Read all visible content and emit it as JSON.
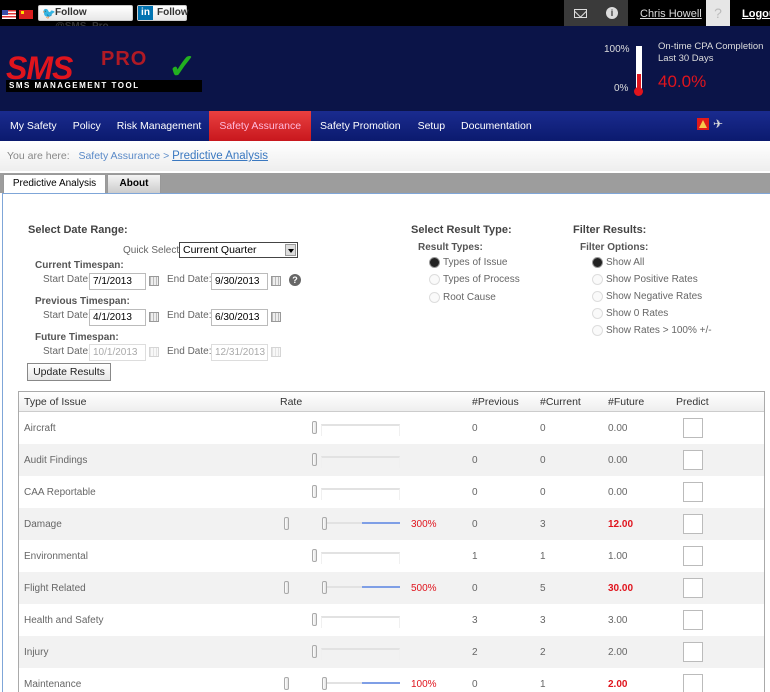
{
  "topbar": {
    "flags": [
      "us-flag-icon",
      "china-flag-icon"
    ],
    "twitter_label": "Follow @SMS_Pro",
    "linkedin_label": "Follow",
    "linkedin_icon_text": "in",
    "user_name": "Chris Howell",
    "logout_label": "Logout"
  },
  "header": {
    "logo": {
      "sms": "SMS",
      "pro": "PRO",
      "subtitle": "SMS MANAGEMENT TOOL",
      "check": "✓"
    },
    "kpi": {
      "scale_max": "100%",
      "scale_min": "0%",
      "title_line1": "On-time CPA Completion",
      "title_line2": "Last 30 Days",
      "value": "40.0%",
      "fill_fraction": 0.4,
      "color": "#e0141d"
    }
  },
  "nav": {
    "items": [
      {
        "label": "My Safety",
        "active": false
      },
      {
        "label": "Policy",
        "active": false
      },
      {
        "label": "Risk Management",
        "active": false
      },
      {
        "label": "Safety Assurance",
        "active": true
      },
      {
        "label": "Safety Promotion",
        "active": false
      },
      {
        "label": "Setup",
        "active": false
      },
      {
        "label": "Documentation",
        "active": false
      }
    ]
  },
  "breadcrumb": {
    "prefix": "You are here:",
    "parent": "Safety Assurance",
    "separator": ">",
    "current": "Predictive Analysis"
  },
  "tabs": [
    {
      "label": "Predictive Analysis",
      "active": true
    },
    {
      "label": "About",
      "active": false
    }
  ],
  "date_range": {
    "title": "Select Date Range:",
    "quick_select_label": "Quick Select:",
    "quick_select_value": "Current Quarter",
    "start_label": "Start Date:",
    "end_label": "End Date:",
    "current": {
      "title": "Current Timespan:",
      "start": "7/1/2013",
      "end": "9/30/2013"
    },
    "previous": {
      "title": "Previous Timespan:",
      "start": "4/1/2013",
      "end": "6/30/2013"
    },
    "future": {
      "title": "Future Timespan:",
      "start": "10/1/2013",
      "end": "12/31/2013"
    },
    "help_icon": "?",
    "update_button": "Update Results"
  },
  "result_type": {
    "title": "Select Result Type:",
    "subtitle": "Result Types:",
    "options": [
      {
        "label": "Types of Issue",
        "selected": true
      },
      {
        "label": "Types of Process",
        "selected": false
      },
      {
        "label": "Root Cause",
        "selected": false
      }
    ]
  },
  "filter": {
    "title": "Filter Results:",
    "subtitle": "Filter Options:",
    "options": [
      {
        "label": "Show All",
        "selected": true
      },
      {
        "label": "Show Positive Rates",
        "selected": false
      },
      {
        "label": "Show Negative Rates",
        "selected": false
      },
      {
        "label": "Show 0 Rates",
        "selected": false
      },
      {
        "label": "Show Rates > 100% +/-",
        "selected": false
      }
    ]
  },
  "table": {
    "headers": [
      "Type of Issue",
      "Rate",
      "#Previous",
      "#Current",
      "#Future",
      "Predict"
    ],
    "rows": [
      {
        "type": "Aircraft",
        "rate": "",
        "rate_value": 0,
        "previous": "0",
        "current": "0",
        "future": "0.00",
        "highlight": false,
        "predict": false
      },
      {
        "type": "Audit Findings",
        "rate": "",
        "rate_value": 0,
        "previous": "0",
        "current": "0",
        "future": "0.00",
        "highlight": false,
        "predict": false
      },
      {
        "type": "CAA Reportable",
        "rate": "",
        "rate_value": 0,
        "previous": "0",
        "current": "0",
        "future": "0.00",
        "highlight": false,
        "predict": false
      },
      {
        "type": "Damage",
        "rate": "300%",
        "rate_value": 300,
        "previous": "0",
        "current": "3",
        "future": "12.00",
        "highlight": true,
        "predict": false
      },
      {
        "type": "Environmental",
        "rate": "",
        "rate_value": 0,
        "previous": "1",
        "current": "1",
        "future": "1.00",
        "highlight": false,
        "predict": false
      },
      {
        "type": "Flight Related",
        "rate": "500%",
        "rate_value": 500,
        "previous": "0",
        "current": "5",
        "future": "30.00",
        "highlight": true,
        "predict": false
      },
      {
        "type": "Health and Safety",
        "rate": "",
        "rate_value": 0,
        "previous": "3",
        "current": "3",
        "future": "3.00",
        "highlight": false,
        "predict": false
      },
      {
        "type": "Injury",
        "rate": "",
        "rate_value": 0,
        "previous": "2",
        "current": "2",
        "future": "2.00",
        "highlight": false,
        "predict": false
      },
      {
        "type": "Maintenance",
        "rate": "100%",
        "rate_value": 100,
        "previous": "0",
        "current": "1",
        "future": "2.00",
        "highlight": true,
        "predict": false
      }
    ]
  }
}
